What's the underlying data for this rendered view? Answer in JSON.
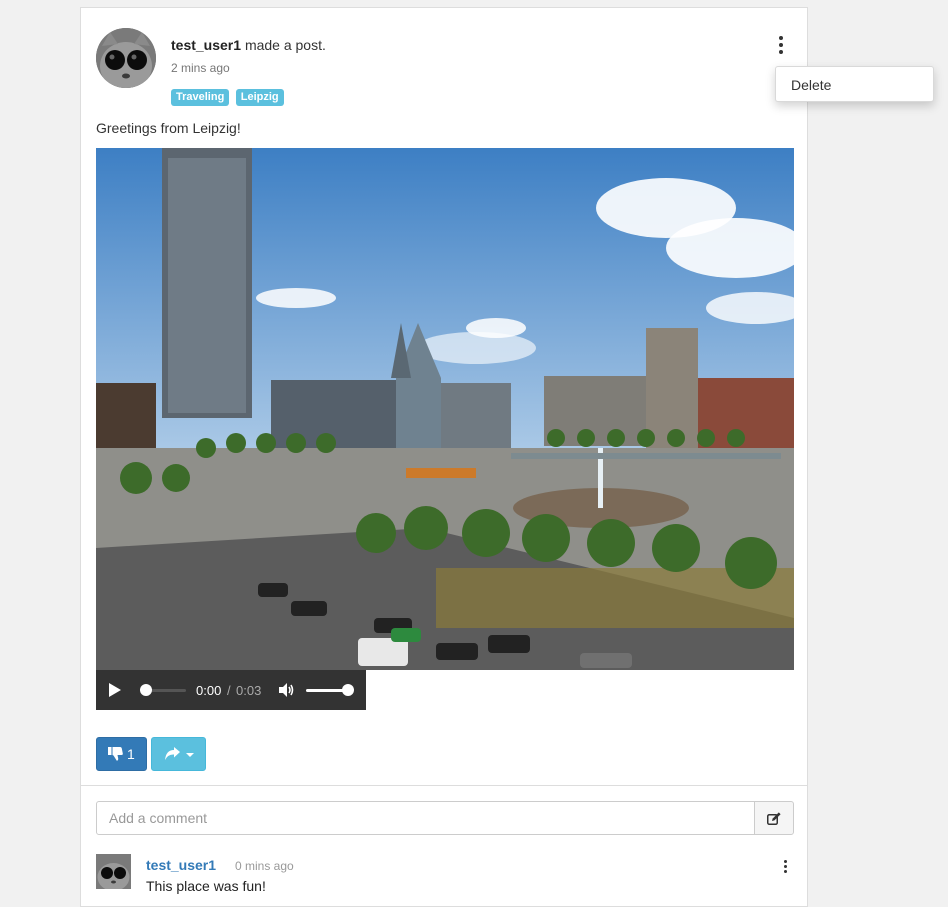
{
  "post": {
    "author": "test_user1",
    "action": "made a post.",
    "time_ago": "2 mins ago",
    "tags": [
      "Traveling",
      "Leipzig"
    ],
    "text": "Greetings from Leipzig!",
    "menu_icon": "vertical-ellipsis-icon"
  },
  "video": {
    "current_time": "0:00",
    "separator": "/",
    "duration": "0:03",
    "progress": 0,
    "volume": 1.0
  },
  "actions": {
    "like_count": "1",
    "like_icon": "thumbs-down-icon",
    "share_icon": "share-icon"
  },
  "comment_form": {
    "placeholder": "Add a comment",
    "submit_icon": "edit-icon"
  },
  "comments": [
    {
      "author": "test_user1",
      "time_ago": "0 mins ago",
      "text": "This place was fun!"
    }
  ],
  "dropdown": {
    "items": [
      "Delete"
    ]
  },
  "colors": {
    "primary": "#337ab7",
    "info": "#5bc0de",
    "player_bg": "#333333"
  }
}
